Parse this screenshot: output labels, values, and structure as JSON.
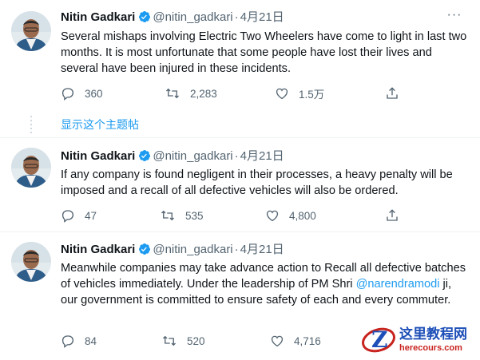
{
  "tweets": [
    {
      "name": "Nitin Gadkari",
      "handle": "@nitin_gadkari",
      "date": "4月21日",
      "text": "Several mishaps involving Electric Two Wheelers have come to light in last two months. It is most unfortunate that some people have lost their lives and several have been injured in these incidents.",
      "replies": "360",
      "retweets": "2,283",
      "likes": "1.5万"
    },
    {
      "name": "Nitin Gadkari",
      "handle": "@nitin_gadkari",
      "date": "4月21日",
      "text": "If any company is found negligent in their processes, a heavy penalty will be imposed and a recall of all defective vehicles will also be ordered.",
      "replies": "47",
      "retweets": "535",
      "likes": "4,800"
    },
    {
      "name": "Nitin Gadkari",
      "handle": "@nitin_gadkari",
      "date": "4月21日",
      "text_before": "Meanwhile companies may take advance action to Recall all defective batches of vehicles immediately. Under the leadership of PM Shri ",
      "mention": "@narendramodi",
      "text_after": " ji, our government is committed to ensure safety of each and every commuter.",
      "replies": "84",
      "retweets": "520",
      "likes": "4,716"
    }
  ],
  "thread_link": "显示这个主题帖",
  "separator": "·",
  "more_glyph": "···",
  "watermark": {
    "title": "这里教程网",
    "subtitle": "herecours.com"
  },
  "colors": {
    "accent": "#1d9bf0",
    "muted": "#536471",
    "verified": "#1d9bf0"
  },
  "icons": [
    "reply-icon",
    "retweet-icon",
    "like-icon",
    "share-icon",
    "verified-badge-icon",
    "more-icon"
  ]
}
